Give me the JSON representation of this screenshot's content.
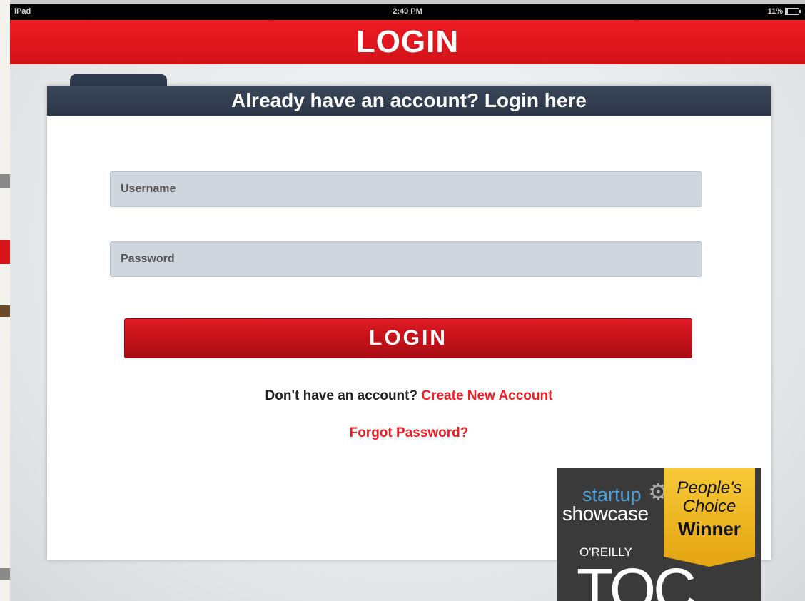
{
  "status_bar": {
    "carrier": "iPad",
    "time": "2:49 PM",
    "battery": "11%"
  },
  "title_bar": {
    "title": "LOGIN"
  },
  "login_card": {
    "header": "Already have an account? Login here",
    "username_placeholder": "Username",
    "password_placeholder": "Password",
    "login_button": "LOGIN",
    "signup_prompt": "Don't have an account?",
    "signup_link": "Create New Account",
    "forgot_link": "Forgot Password?"
  },
  "badge": {
    "startup": "startup",
    "showcase": "showcase",
    "peoples": "People's",
    "choice": "Choice",
    "winner": "Winner",
    "oreilly": "O'REILLY",
    "toc": "TOC"
  },
  "colors": {
    "brand_red": "#e8161e",
    "header_navy": "#323d50",
    "field_bg": "#cfd6de",
    "ribbon_gold": "#f0b824"
  }
}
